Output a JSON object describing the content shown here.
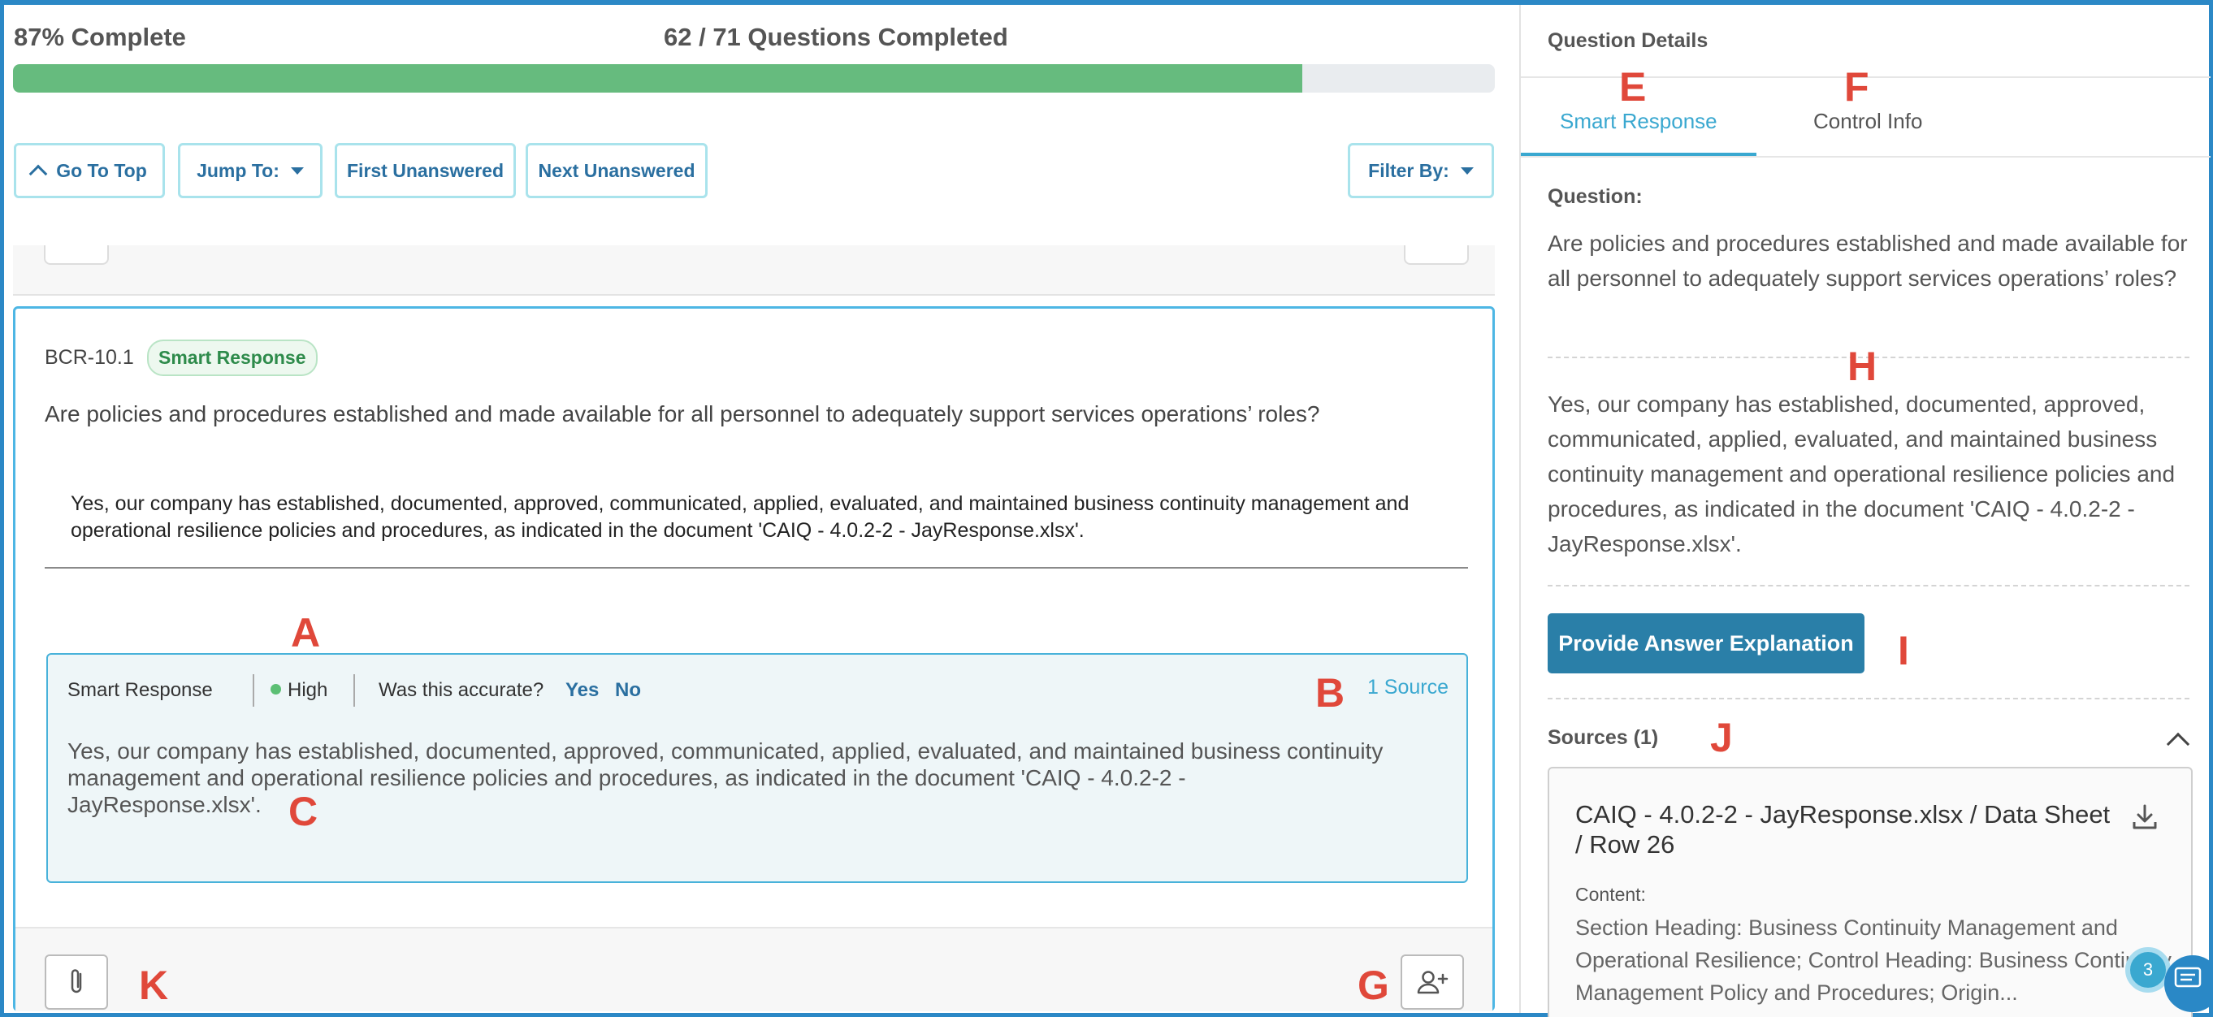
{
  "progress": {
    "percent_label": "87% Complete",
    "questions_label": "62 / 71 Questions Completed",
    "fraction": 0.87
  },
  "toolbar": {
    "go_to_top": "Go To Top",
    "jump_to": "Jump To:",
    "first_unanswered": "First Unanswered",
    "next_unanswered": "Next Unanswered",
    "filter_by": "Filter By:"
  },
  "question_card": {
    "id": "BCR-10.1",
    "badge": "Smart Response",
    "question": "Are policies and procedures established and made available for all personnel to adequately support services operations’ roles?",
    "answer": "Yes, our company has established, documented, approved, communicated, applied, evaluated, and maintained business continuity management and operational resilience policies and procedures, as indicated in the document 'CAIQ - 4.0.2-2 - JayResponse.xlsx'.",
    "smart_response": {
      "label": "Smart Response",
      "confidence": "High",
      "accuracy_prompt": "Was this accurate?",
      "yes": "Yes",
      "no": "No",
      "sources_link": "1 Source",
      "text": "Yes, our company has established, documented, approved, communicated, applied, evaluated, and maintained business continuity management and operational resilience policies and procedures, as indicated in the document 'CAIQ - 4.0.2-2 - JayResponse.xlsx'."
    }
  },
  "annotations": {
    "A": "A",
    "B": "B",
    "C": "C",
    "E": "E",
    "F": "F",
    "G": "G",
    "H": "H",
    "I": "I",
    "J": "J",
    "K": "K"
  },
  "details": {
    "heading": "Question Details",
    "tabs": [
      "Smart Response",
      "Control Info"
    ],
    "active_tab": "Smart Response",
    "question_label": "Question:",
    "question": "Are policies and procedures established and made available for all personnel to adequately support services operations’ roles?",
    "answer": "Yes, our company has established, documented, approved, communicated, applied, evaluated, and maintained business continuity management and operational resilience policies and procedures, as indicated in the document 'CAIQ - 4.0.2-2 - JayResponse.xlsx'.",
    "explain_button": "Provide Answer Explanation",
    "sources_heading": "Sources (1)",
    "source": {
      "title": "CAIQ - 4.0.2-2 - JayResponse.xlsx / Data Sheet / Row 26",
      "content_label": "Content:",
      "content": "Section Heading: Business Continuity Management and Operational Resilience; Control Heading: Business Continuity Management Policy and Procedures; Origin..."
    }
  },
  "chat": {
    "badge_count": "3"
  },
  "colors": {
    "accent": "#3aa8d0",
    "progress": "#66bb7e",
    "annotation": "#e0483a",
    "primary_button": "#2a7fa8"
  }
}
